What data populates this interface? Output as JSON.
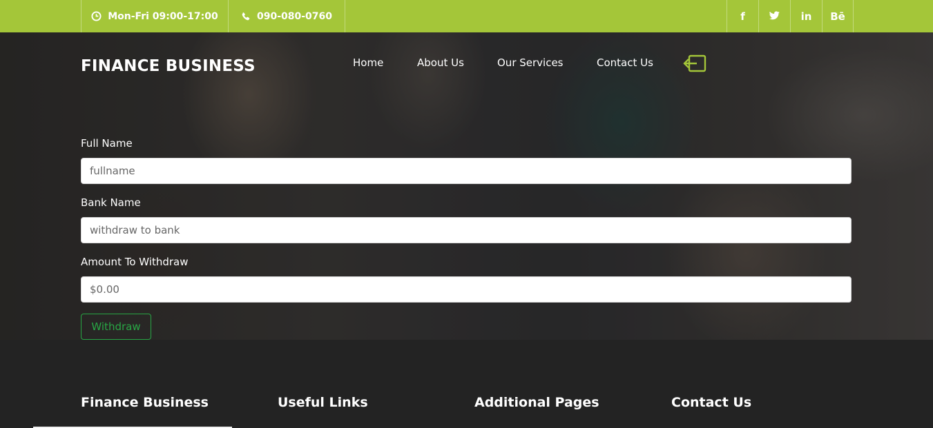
{
  "topbar": {
    "hours": "Mon-Fri 09:00-17:00",
    "phone": "090-080-0760",
    "socials": [
      {
        "icon": "facebook-icon",
        "label": "f"
      },
      {
        "icon": "twitter-icon",
        "label": ""
      },
      {
        "icon": "linkedin-icon",
        "label": "in"
      },
      {
        "icon": "behance-icon",
        "label": "Bē"
      }
    ],
    "bar_color": "#a4c639"
  },
  "header": {
    "logo": "FINANCE BUSINESS",
    "nav": [
      "Home",
      "About Us",
      "Our Services",
      "Contact Us"
    ],
    "logout_icon": "logout-icon",
    "accent_color": "#a4c639"
  },
  "form": {
    "full_name_label": "Full Name",
    "full_name_placeholder": "fullname",
    "bank_label": "Bank Name",
    "bank_placeholder": "withdraw to bank",
    "amount_label": "Amount To Withdraw",
    "amount_placeholder": "$0.00",
    "submit_label": "Withdraw",
    "submit_color": "#28a745"
  },
  "footer": {
    "headings": [
      "Finance Business",
      "Useful Links",
      "Additional Pages",
      "Contact Us"
    ],
    "background": "#232323"
  }
}
